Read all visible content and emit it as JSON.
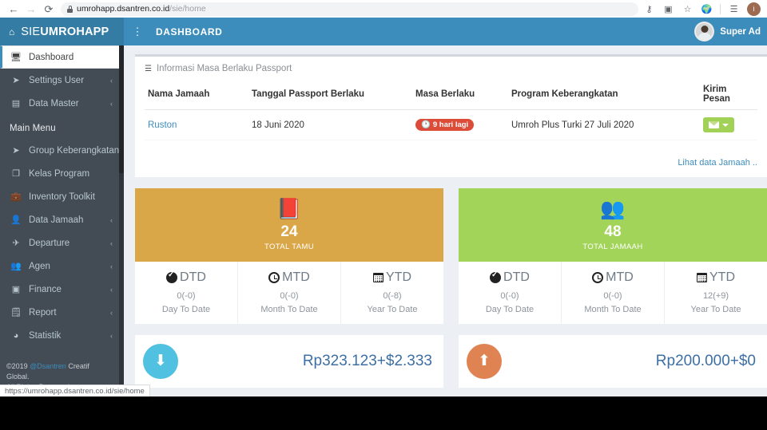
{
  "browser": {
    "back_icon": "←",
    "forward_icon": "→",
    "reload_icon": "⟳",
    "url_host": "umrohapp.dsantren.co.id",
    "url_path": "/sie/home",
    "toolbar_icons": [
      "key-icon",
      "extension-icon",
      "bookmark-star-icon",
      "globe-icon",
      "reading-list-icon"
    ],
    "status_url": "https://umrohapp.dsantren.co.id/sie/home"
  },
  "header": {
    "logo_light": "SIE",
    "logo_bold": "UMROHAPP",
    "nav_title": "DASHBOARD",
    "username": "Super Ad"
  },
  "sidebar": {
    "items_top": [
      {
        "label": "Dashboard",
        "icon": "desktop-icon",
        "active": true,
        "caret": ""
      },
      {
        "label": "Settings User",
        "icon": "paper-plane-icon",
        "active": false,
        "caret": "‹"
      },
      {
        "label": "Data Master",
        "icon": "database-icon",
        "active": false,
        "caret": "‹"
      }
    ],
    "section_label": "Main Menu",
    "items_main": [
      {
        "label": "Group Keberangkatan",
        "icon": "paper-plane-icon",
        "caret": ""
      },
      {
        "label": "Kelas Program",
        "icon": "copy-icon",
        "caret": ""
      },
      {
        "label": "Inventory Toolkit",
        "icon": "briefcase-icon",
        "caret": ""
      },
      {
        "label": "Data Jamaah",
        "icon": "user-icon",
        "caret": "‹"
      },
      {
        "label": "Departure",
        "icon": "plane-icon",
        "caret": "‹"
      },
      {
        "label": "Agen",
        "icon": "users-icon",
        "caret": "‹"
      },
      {
        "label": "Finance",
        "icon": "money-icon",
        "caret": "‹"
      },
      {
        "label": "Report",
        "icon": "newspaper-icon",
        "caret": "‹"
      },
      {
        "label": "Statistik",
        "icon": "pie-chart-icon",
        "caret": "‹"
      }
    ],
    "footer_copy": "©2019 ",
    "footer_link": "@Dsantren",
    "footer_tail": " Creatif Global.",
    "footer_line2": "All Rights Reserved"
  },
  "passport_panel": {
    "title": "Informasi Masa Berlaku Passport",
    "bars_icon": "bars-icon",
    "columns": [
      "Nama Jamaah",
      "Tanggal Passport Berlaku",
      "Masa Berlaku",
      "Program Keberangkatan",
      "Kirim Pesan"
    ],
    "rows": [
      {
        "nama": "Ruston",
        "tanggal": "18 Juni 2020",
        "masa_berlaku": "9 hari lagi",
        "masa_icon": "clock-icon",
        "program": "Umroh Plus Turki 27 Juli 2020",
        "action_icon": "envelope-icon",
        "action_caret": "caret-down-icon"
      }
    ],
    "footer_link": "Lihat data Jamaah .."
  },
  "stat_cards": [
    {
      "color": "#d9a748",
      "icon": "book-icon",
      "icon_glyph": "📕",
      "number": "24",
      "caption": "TOTAL TAMU",
      "metrics": [
        {
          "title": "DTD",
          "icon": "check-circle-icon",
          "value": "0(-0)",
          "sub": "Day To Date"
        },
        {
          "title": "MTD",
          "icon": "clock-icon",
          "value": "0(-0)",
          "sub": "Month To Date"
        },
        {
          "title": "YTD",
          "icon": "calendar-icon",
          "value": "0(-8)",
          "sub": "Year To Date"
        }
      ]
    },
    {
      "color": "#a3d45a",
      "icon": "users-icon",
      "icon_glyph": "👥",
      "number": "48",
      "caption": "TOTAL JAMAAH",
      "metrics": [
        {
          "title": "DTD",
          "icon": "check-circle-icon",
          "value": "0(-0)",
          "sub": "Day To Date"
        },
        {
          "title": "MTD",
          "icon": "clock-icon",
          "value": "0(-0)",
          "sub": "Month To Date"
        },
        {
          "title": "YTD",
          "icon": "calendar-icon",
          "value": "12(+9)",
          "sub": "Year To Date"
        }
      ]
    }
  ],
  "money_cards": [
    {
      "icon": "arrow-down-icon",
      "glyph": "⬇",
      "color": "#50c1e0",
      "amount": "Rp323.123+$2.333"
    },
    {
      "icon": "arrow-up-icon",
      "glyph": "⬆",
      "color": "#e08352",
      "amount": "Rp200.000+$0"
    }
  ]
}
